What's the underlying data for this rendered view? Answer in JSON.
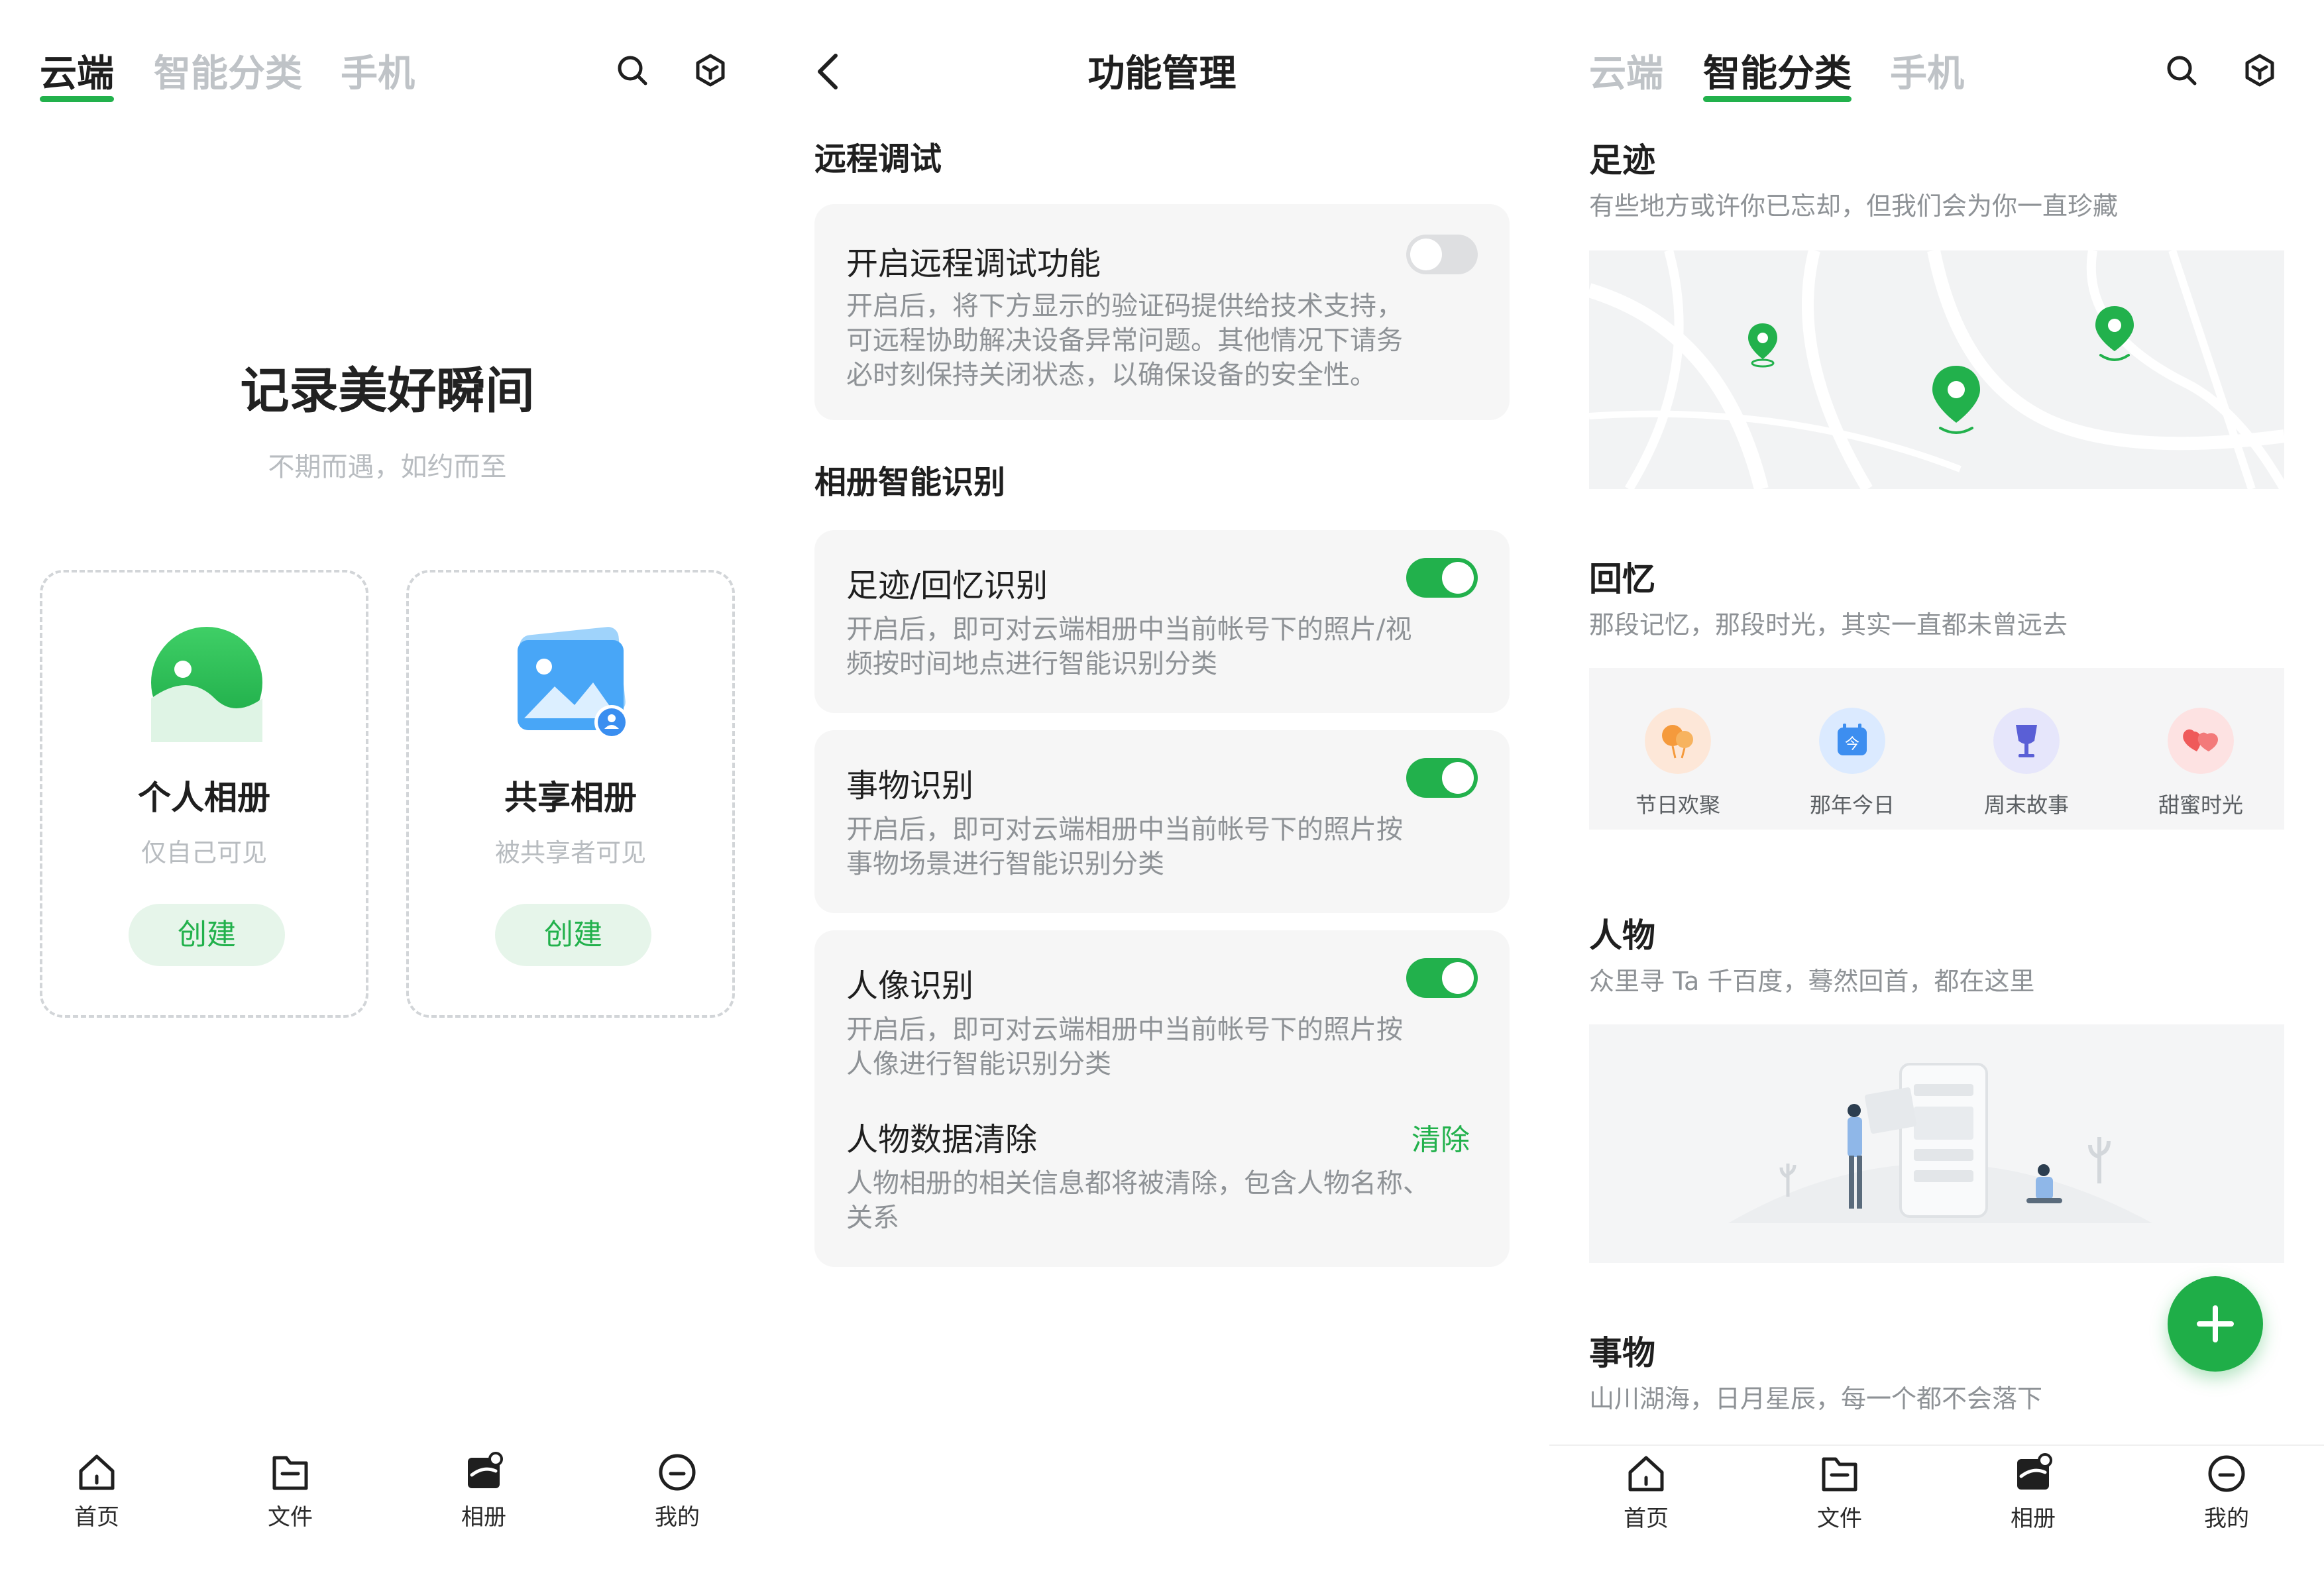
{
  "panel1": {
    "tabs": [
      "云端",
      "智能分类",
      "手机"
    ],
    "active_tab": 0,
    "hero_title": "记录美好瞬间",
    "hero_subtitle": "不期而遇，如约而至",
    "albums": [
      {
        "title": "个人相册",
        "subtitle": "仅自己可见",
        "button": "创建"
      },
      {
        "title": "共享相册",
        "subtitle": "被共享者可见",
        "button": "创建"
      }
    ],
    "nav": [
      "首页",
      "文件",
      "相册",
      "我的"
    ]
  },
  "panel2": {
    "title": "功能管理",
    "section_remote": "远程调试",
    "remote_card": {
      "title": "开启远程调试功能",
      "toggle_on": false,
      "desc_lines": [
        "开启后，将下方显示的验证码提供给技术支持，",
        "可远程协助解决设备异常问题。其他情况下请务",
        "必时刻保持关闭状态，以确保设备的安全性。"
      ]
    },
    "section_ai": "相册智能识别",
    "ai_cards": [
      {
        "title": "足迹/回忆识别",
        "toggle_on": true,
        "desc_lines": [
          "开启后，即可对云端相册中当前帐号下的照片/视",
          "频按时间地点进行智能识别分类"
        ]
      },
      {
        "title": "事物识别",
        "toggle_on": true,
        "desc_lines": [
          "开启后，即可对云端相册中当前帐号下的照片按",
          "事物场景进行智能识别分类"
        ]
      },
      {
        "title": "人像识别",
        "toggle_on": true,
        "desc_lines": [
          "开启后，即可对云端相册中当前帐号下的照片按",
          "人像进行智能识别分类"
        ]
      }
    ],
    "people_clear": {
      "title": "人物数据清除",
      "action": "清除",
      "desc_lines": [
        "人物相册的相关信息都将被清除，包含人物名称、",
        "关系"
      ]
    }
  },
  "panel3": {
    "tabs": [
      "云端",
      "智能分类",
      "手机"
    ],
    "active_tab": 1,
    "sections": [
      {
        "title": "足迹",
        "subtitle": "有些地方或许你已忘却，但我们会为你一直珍藏"
      },
      {
        "title": "回忆",
        "subtitle": "那段记忆，那段时光，其实一直都未曾远去"
      },
      {
        "title": "人物",
        "subtitle": "众里寻 Ta 千百度，蓦然回首，都在这里"
      },
      {
        "title": "事物",
        "subtitle": "山川湖海，日月星辰，每一个都不会落下"
      }
    ],
    "memory_categories": [
      {
        "label": "节日欢聚",
        "color": "#fde7d8",
        "icon_color": "#f59a3c"
      },
      {
        "label": "那年今日",
        "color": "#dbeaff",
        "icon_color": "#3d8ef0",
        "icon_text": "今"
      },
      {
        "label": "周末故事",
        "color": "#e6e6fb",
        "icon_color": "#5a5fd6"
      },
      {
        "label": "甜蜜时光",
        "color": "#fde2e2",
        "icon_color": "#ef5a5a"
      }
    ],
    "nav": [
      "首页",
      "文件",
      "相册",
      "我的"
    ],
    "accent": "#22b14c"
  }
}
